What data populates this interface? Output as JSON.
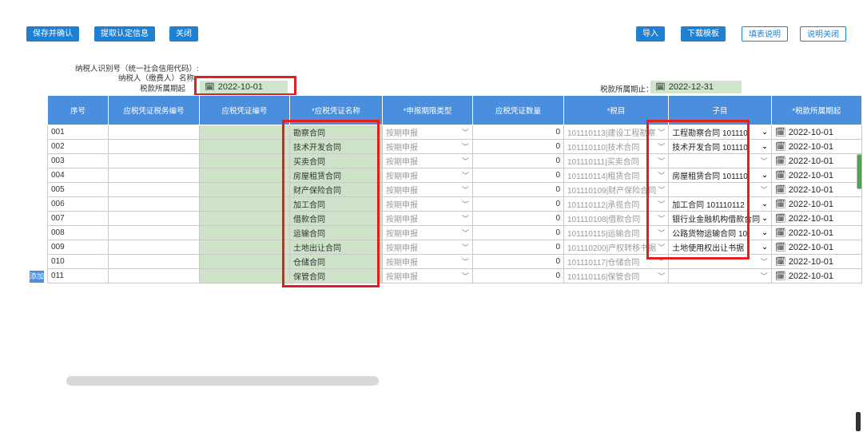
{
  "toolbar": {
    "save_confirm": "保存并确认",
    "fetch_info": "提取认定信息",
    "close": "关闭",
    "import": "导入",
    "download_template": "下载模板",
    "fill_instructions": "填表说明",
    "close_instructions": "说明关闭"
  },
  "header_info": {
    "taxpayer_id_label": "纳税人识别号（统一社会信用代码）:",
    "taxpayer_name_label": "纳税人（缴费人）名称:",
    "period_start_label": "税款所属期起",
    "period_start_value": "2022-10-01",
    "period_end_label": "税款所属期止：",
    "period_end_value": "2022-12-31"
  },
  "table": {
    "columns": [
      "序号",
      "应税凭证税务编号",
      "应税凭证编号",
      "*应税凭证名称",
      "*申报期限类型",
      "应税凭证数量",
      "*税目",
      "子目",
      "*税款所属期起"
    ],
    "rows": [
      {
        "no": "001",
        "name": "勘察合同",
        "period_type": "按期申报",
        "qty": "0",
        "item": "101110113|建设工程勘察",
        "subitem": "工程勘察合同 101110",
        "start": "2022-10-01"
      },
      {
        "no": "002",
        "name": "技术开发合同",
        "period_type": "按期申报",
        "qty": "0",
        "item": "101110110|技术合同",
        "subitem": "技术开发合同 101110",
        "start": "2022-10-01"
      },
      {
        "no": "003",
        "name": "买卖合同",
        "period_type": "按期申报",
        "qty": "0",
        "item": "101110111|买卖合同",
        "subitem": "",
        "start": "2022-10-01"
      },
      {
        "no": "004",
        "name": "房屋租赁合同",
        "period_type": "按期申报",
        "qty": "0",
        "item": "101110114|租赁合同",
        "subitem": "房屋租赁合同 101110",
        "start": "2022-10-01"
      },
      {
        "no": "005",
        "name": "财产保险合同",
        "period_type": "按期申报",
        "qty": "0",
        "item": "101110109|财产保险合同",
        "subitem": "",
        "start": "2022-10-01"
      },
      {
        "no": "006",
        "name": "加工合同",
        "period_type": "按期申报",
        "qty": "0",
        "item": "101110112|承揽合同",
        "subitem": "加工合同 101110112",
        "start": "2022-10-01"
      },
      {
        "no": "007",
        "name": "借款合同",
        "period_type": "按期申报",
        "qty": "0",
        "item": "101110108|借款合同",
        "subitem": "银行业金融机构借款合同",
        "start": "2022-10-01"
      },
      {
        "no": "008",
        "name": "运输合同",
        "period_type": "按期申报",
        "qty": "0",
        "item": "101110115|运输合同",
        "subitem": "公路货物运输合同 10",
        "start": "2022-10-01"
      },
      {
        "no": "009",
        "name": "土地出让合同",
        "period_type": "按期申报",
        "qty": "0",
        "item": "101110200|产权转移书据",
        "subitem": "土地使用权出让书据",
        "start": "2022-10-01"
      },
      {
        "no": "010",
        "name": "仓储合同",
        "period_type": "按期申报",
        "qty": "0",
        "item": "101110117|仓储合同",
        "subitem": "",
        "start": "2022-10-01"
      },
      {
        "no": "011",
        "name": "保管合同",
        "period_type": "按期申报",
        "qty": "0",
        "item": "101110116|保管合同",
        "subitem": "",
        "start": "2022-10-01"
      }
    ]
  },
  "add_button": "添加",
  "icons": {
    "calendar": "calendar-icon",
    "dropdown": "chevron-down-icon"
  },
  "colors": {
    "primary": "#1f7fd0",
    "header": "#4a8ede",
    "editable": "#cde3c7",
    "highlight": "#e0201e"
  }
}
